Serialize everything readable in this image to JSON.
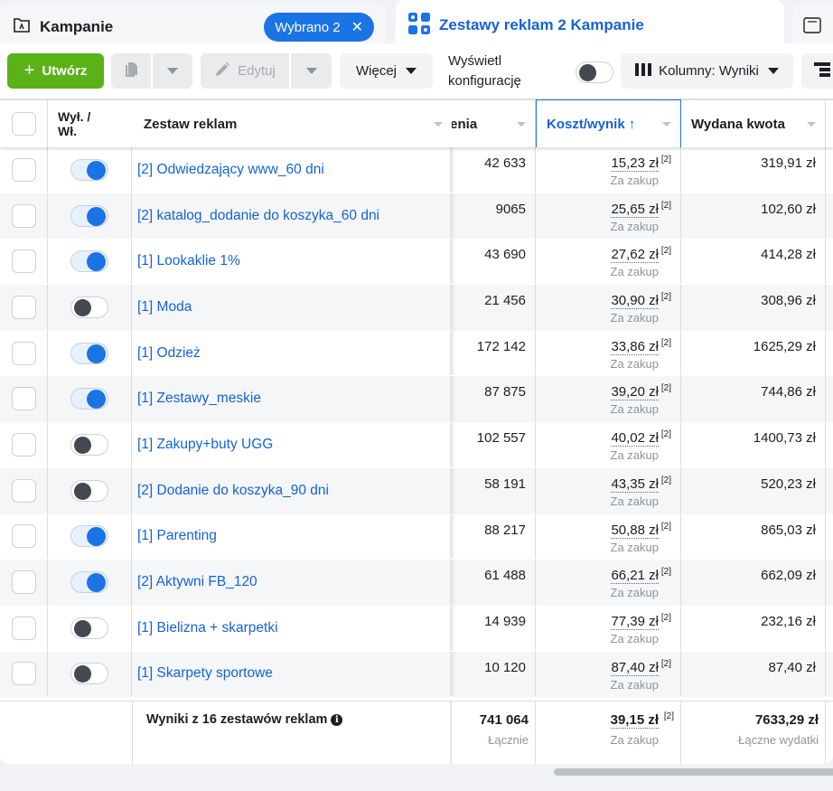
{
  "tabs": {
    "campaigns": {
      "label": "Kampanie",
      "icon": "folder-icon",
      "badge": "Wybrano 2",
      "badge_close": "✕"
    },
    "adsets": {
      "label": "Zestawy reklam 2 Kampanie",
      "icon": "grid-icon"
    },
    "ads": {
      "icon": "ad-window-icon"
    }
  },
  "toolbar": {
    "create_label": "Utwórz",
    "create_icon": "+",
    "duplicate_icon": "duplicate-icon",
    "edit_label": "Edytuj",
    "more_label": "Więcej",
    "config_label_line1": "Wyświetl",
    "config_label_line2": "konfigurację",
    "config_toggle_on": false,
    "columns_label": "Kolumny: Wyniki",
    "breakdown_icon": "breakdown-icon"
  },
  "table": {
    "headers": {
      "onoff_line1": "Wył. /",
      "onoff_line2": "Wł.",
      "name": "Zestaw reklam",
      "reach": "Wyświetlenia",
      "reach_visible": "lenia",
      "cost": "Koszt/wynik",
      "cost_sort": "↑",
      "spend": "Wydana kwota"
    },
    "cost_sub": "Za zakup",
    "footnote": "[2]",
    "rows": [
      {
        "on": true,
        "name": "[2] Odwiedzający www_60 dni",
        "reach": "42 633",
        "cost": "15,23 zł",
        "spend": "319,91 zł"
      },
      {
        "on": true,
        "name": "[2] katalog_dodanie do koszyka_60 dni",
        "reach": "9065",
        "cost": "25,65 zł",
        "spend": "102,60 zł"
      },
      {
        "on": true,
        "name": "[1] Lookaklie 1%",
        "reach": "43 690",
        "cost": "27,62 zł",
        "spend": "414,28 zł"
      },
      {
        "on": false,
        "name": "[1] Moda",
        "reach": "21 456",
        "cost": "30,90 zł",
        "spend": "308,96 zł"
      },
      {
        "on": true,
        "name": "[1] Odzież",
        "reach": "172 142",
        "cost": "33,86 zł",
        "spend": "1625,29 zł"
      },
      {
        "on": true,
        "name": "[1] Zestawy_meskie",
        "reach": "87 875",
        "cost": "39,20 zł",
        "spend": "744,86 zł"
      },
      {
        "on": false,
        "name": "[1] Zakupy+buty UGG",
        "reach": "102 557",
        "cost": "40,02 zł",
        "spend": "1400,73 zł"
      },
      {
        "on": false,
        "name": "[2] Dodanie do koszyka_90 dni",
        "reach": "58 191",
        "cost": "43,35 zł",
        "spend": "520,23 zł"
      },
      {
        "on": true,
        "name": "[1] Parenting",
        "reach": "88 217",
        "cost": "50,88 zł",
        "spend": "865,03 zł"
      },
      {
        "on": true,
        "name": "[2] Aktywni FB_120",
        "reach": "61 488",
        "cost": "66,21 zł",
        "spend": "662,09 zł"
      },
      {
        "on": false,
        "name": "[1] Bielizna + skarpetki",
        "reach": "14 939",
        "cost": "77,39 zł",
        "spend": "232,16 zł"
      },
      {
        "on": false,
        "name": "[1] Skarpety sportowe",
        "reach": "10 120",
        "cost": "87,40 zł",
        "spend": "87,40 zł"
      }
    ],
    "footer": {
      "label": "Wyniki z 16 zestawów reklam",
      "info_icon": "i",
      "reach": "741 064",
      "reach_sub": "Łącznie",
      "cost": "39,15 zł",
      "cost_sub": "Za zakup",
      "footnote": "[2]",
      "spend": "7633,29 zł",
      "spend_sub": "Łączne wydatki"
    }
  },
  "colors": {
    "brand_blue": "#1b74e4",
    "link_blue": "#1463d6",
    "create_green": "#5ab118"
  }
}
